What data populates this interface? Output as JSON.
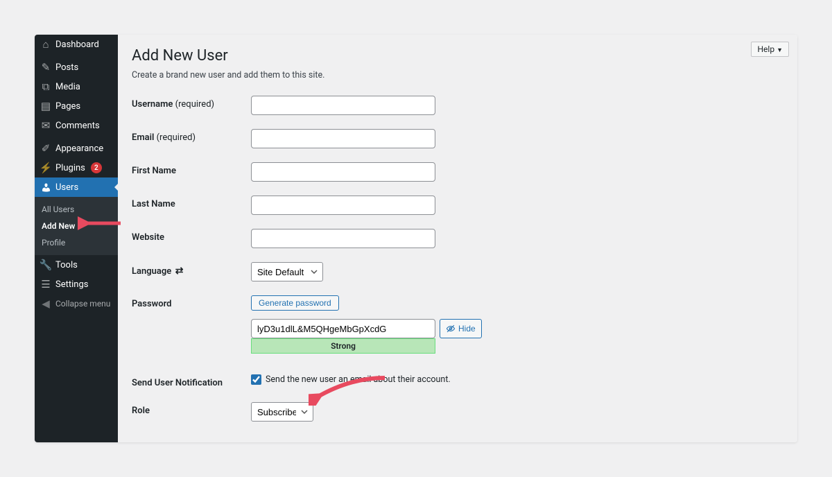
{
  "sidebar": {
    "items": [
      {
        "label": "Dashboard",
        "icon": "dashboard-icon",
        "glyph": "⌂"
      },
      {
        "label": "Posts",
        "icon": "posts-icon",
        "glyph": "✎"
      },
      {
        "label": "Media",
        "icon": "media-icon",
        "glyph": "⧉"
      },
      {
        "label": "Pages",
        "icon": "pages-icon",
        "glyph": "▤"
      },
      {
        "label": "Comments",
        "icon": "comments-icon",
        "glyph": "✉"
      },
      {
        "label": "Appearance",
        "icon": "appearance-icon",
        "glyph": "✐"
      },
      {
        "label": "Plugins",
        "icon": "plugins-icon",
        "glyph": "⚡",
        "badge": "2"
      },
      {
        "label": "Users",
        "icon": "users-icon",
        "glyph": "👤",
        "active": true
      },
      {
        "label": "Tools",
        "icon": "tools-icon",
        "glyph": "🔧"
      },
      {
        "label": "Settings",
        "icon": "settings-icon",
        "glyph": "☰"
      }
    ],
    "submenu": [
      {
        "label": "All Users"
      },
      {
        "label": "Add New",
        "current": true
      },
      {
        "label": "Profile"
      }
    ],
    "collapse": "Collapse menu"
  },
  "header": {
    "title": "Add New User",
    "subtitle": "Create a brand new user and add them to this site.",
    "help": "Help"
  },
  "form": {
    "username_label": "Username",
    "required": "(required)",
    "email_label": "Email",
    "firstname_label": "First Name",
    "lastname_label": "Last Name",
    "website_label": "Website",
    "language_label": "Language",
    "language_value": "Site Default",
    "password_label": "Password",
    "generate_password": "Generate password",
    "password_value": "lyD3u1dlL&M5QHgeMbGpXcdG",
    "hide_label": "Hide",
    "strength": "Strong",
    "notification_label": "Send User Notification",
    "notification_text": "Send the new user an email about their account.",
    "notification_checked": true,
    "role_label": "Role",
    "role_value": "Subscriber"
  }
}
